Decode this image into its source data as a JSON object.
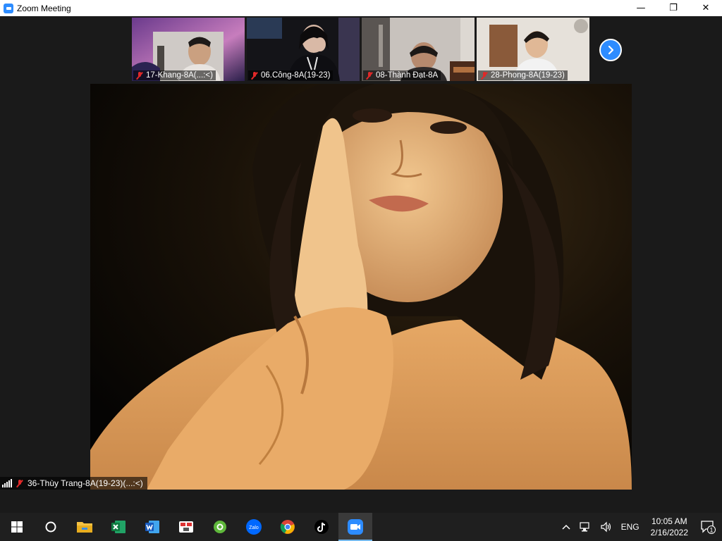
{
  "window": {
    "title": "Zoom Meeting",
    "minimize": "—",
    "maximize": "❐",
    "close": "✕"
  },
  "participants": [
    {
      "name": "17-Khang-8A(...:<)",
      "muted": true
    },
    {
      "name": "06.Công-8A(19-23)",
      "muted": true
    },
    {
      "name": "08-Thành Đạt-8A",
      "muted": true
    },
    {
      "name": "28-Phong-8A(19-23)",
      "muted": true
    }
  ],
  "next_page_icon": "chevron-right-icon",
  "speaker": {
    "name": "36-Thùy Trang-8A(19-23)(...:<)",
    "muted": true
  },
  "taskbar": {
    "apps": [
      "start-icon",
      "cortana-icon",
      "file-explorer-icon",
      "excel-icon",
      "word-icon",
      "app-icon",
      "coccoc-icon",
      "zalo-icon",
      "chrome-icon",
      "tiktok-icon",
      "zoom-icon"
    ],
    "zalo_label": "Zalo",
    "language": "ENG",
    "time": "10:05 AM",
    "date": "2/16/2022",
    "notification_count": "1"
  },
  "colors": {
    "zoom_blue": "#2d8cff",
    "muted_red": "#e02828",
    "taskbar": "#1f1f1f",
    "stage": "#1a1a1a"
  }
}
